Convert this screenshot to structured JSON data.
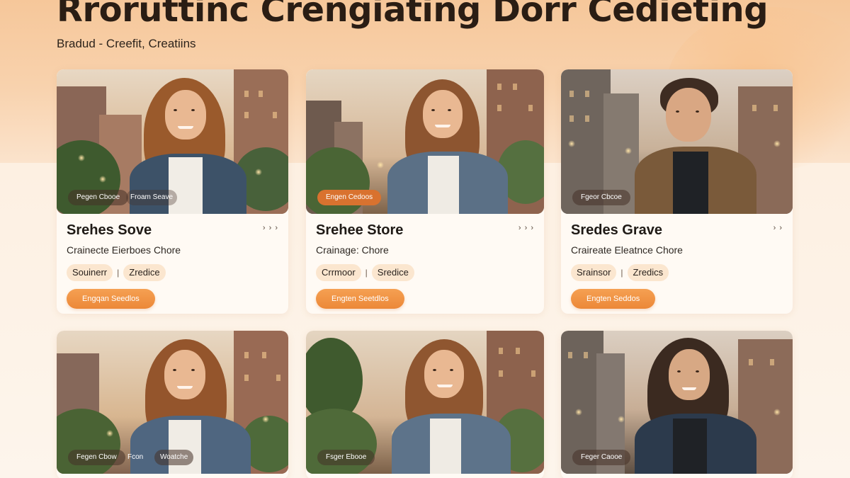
{
  "header": {
    "title": "Rroruttinc Crengiating Dorr Cedieting",
    "subtitle": "Bradud - Creefit, Creatiins"
  },
  "cards": [
    {
      "photo_tag": "Pegen Cbooe",
      "photo_tag_2": "Froam Seave",
      "name": "Srehes Sove",
      "chevron": "› › ›",
      "description": "Crainecte Eierboes Chore",
      "chip_1": "Souinerr",
      "chip_2": "Zredice",
      "cta": "Engqan Seedlos"
    },
    {
      "photo_tag": "Engen Cedoos",
      "name": "Srehee Store",
      "chevron": "› › ›",
      "description": "Crainage: Chore",
      "chip_1": "Crrmoor",
      "chip_2": "Sredice",
      "cta": "Engten Seetdlos"
    },
    {
      "photo_tag": "Fgeor Cbcoe",
      "name": "Sredes Grave",
      "chevron": "› ›",
      "description": "Craireate Eleatnce Chore",
      "chip_1": "Srainsor",
      "chip_2": "Zredics",
      "cta": "Engten Seddos"
    },
    {
      "photo_tag": "Fegen Cbow",
      "photo_tag_2": "Fcon",
      "photo_tag_3": "Woatche"
    },
    {
      "photo_tag": "Fsger Ebooe"
    },
    {
      "photo_tag": "Feger Caooe"
    }
  ],
  "colors": {
    "accent": "#ec8838",
    "chip_bg": "#fbe6cf",
    "card_bg": "#fffaf4"
  }
}
